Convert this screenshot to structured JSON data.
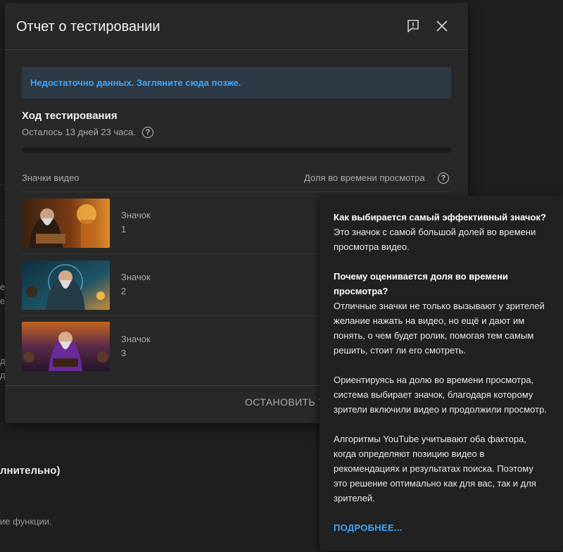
{
  "background": {
    "fragment_1": "е",
    "fragment_2": "е",
    "fragment_3": "д",
    "fragment_4": "д",
    "heading_partial": "лнительно)",
    "footer_partial": "ие функции."
  },
  "dialog": {
    "title": "Отчет о тестировании",
    "feedback_icon": "feedback-icon",
    "close_icon": "close-icon",
    "alert_text": "Недостаточно данных. Загляните сюда позже.",
    "progress": {
      "title": "Ход тестирования",
      "remaining": "Осталось 13 дней 23 часа.",
      "fraction": 0.0
    },
    "columns": {
      "thumbnails": "Значки видео",
      "watch_share": "Доля во времени просмотра"
    },
    "thumbnails": [
      {
        "label": "Значок",
        "number": "1"
      },
      {
        "label": "Значок",
        "number": "2"
      },
      {
        "label": "Значок",
        "number": "3"
      }
    ],
    "stop_button": "ОСТАНОВИТЬ Т"
  },
  "tooltip": {
    "q1": "Как выбирается самый эффективный значок?",
    "a1": "Это значок с самой большой долей во времени просмотра видео.",
    "q2": "Почему оценивается доля во времени просмотра?",
    "a2": "Отличные значки не только вызывают у зрителей желание нажать на видео, но ещё и дают им понять, о чем будет ролик, помогая тем самым решить, стоит ли его смотреть.",
    "p3": "Ориентируясь на долю во времени просмотра, система выбирает значок, благодаря которому зрители включили видео и продолжили просмотр.",
    "p4": "Алгоритмы YouTube учитывают оба фактора, когда определяют позицию видео в рекомендациях и результатах поиска. Поэтому это решение оптимально как для вас, так и для зрителей.",
    "learn_more": "ПОДРОБНЕЕ..."
  },
  "colors": {
    "accent": "#3ea6ff",
    "dialog_bg": "#282828",
    "page_bg": "#1f1f1f"
  }
}
